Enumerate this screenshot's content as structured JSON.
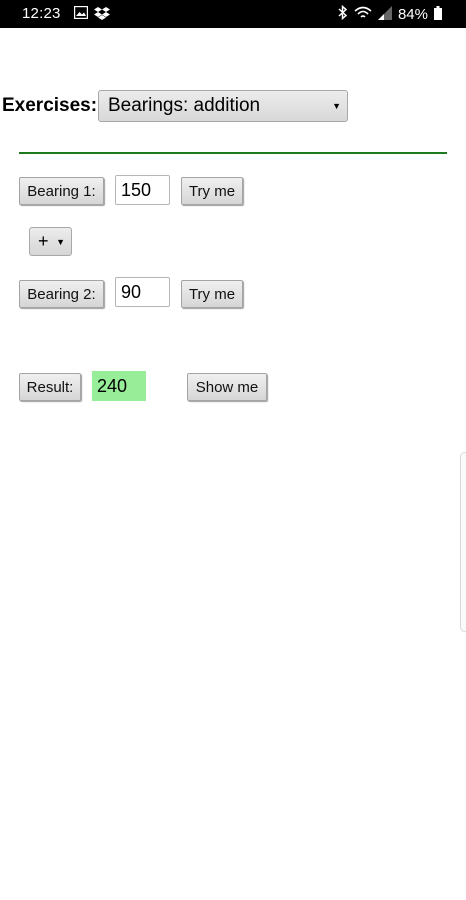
{
  "status_bar": {
    "time": "12:23",
    "left_icons": [
      "image-icon",
      "dropbox-icon"
    ],
    "right_icons": [
      "bluetooth-icon",
      "wifi-icon",
      "signal-icon",
      "battery-icon"
    ],
    "battery": "84%"
  },
  "exercises": {
    "label": "Exercises:",
    "selected": "Bearings: addition"
  },
  "bearing1": {
    "button_label": "Bearing 1:",
    "value": "150",
    "try_label": "Try me"
  },
  "operator": {
    "selected": "+"
  },
  "bearing2": {
    "button_label": "Bearing 2:",
    "value": "90",
    "try_label": "Try me"
  },
  "result": {
    "button_label": "Result:",
    "value": "240",
    "show_label": "Show me"
  },
  "colors": {
    "divider": "#1e7a1e",
    "result_bg": "#98ee98"
  }
}
